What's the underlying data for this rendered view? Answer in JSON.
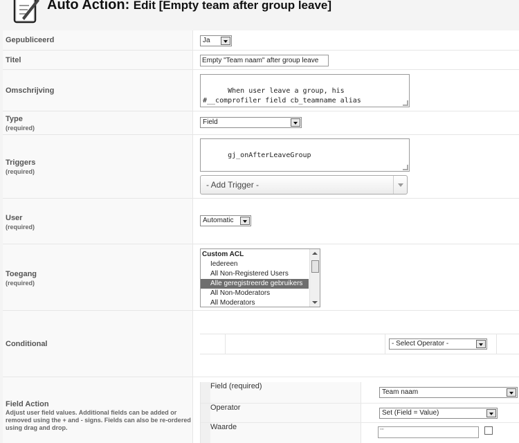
{
  "header": {
    "title_main": "Auto Action:",
    "title_sub": "Edit [Empty team after group leave]",
    "logo_icon": "document-edit-icon"
  },
  "fields": {
    "published": {
      "label": "Gepubliceerd",
      "value": "Ja"
    },
    "title": {
      "label": "Titel",
      "value": "Empty \"Team naam\" after group leave"
    },
    "description": {
      "label": "Omschrijving",
      "value": "When user leave a group, his\n#__comprofiler field cb_teamname alias\n\"Team naam\" has to become empty."
    },
    "type": {
      "label": "Type",
      "required": "(required)",
      "value": "Field"
    },
    "triggers": {
      "label": "Triggers",
      "required": "(required)",
      "value": "gj_onAfterLeaveGroup",
      "add_placeholder": "- Add Trigger -"
    },
    "user": {
      "label": "User",
      "required": "(required)",
      "value": "Automatic"
    },
    "access": {
      "label": "Toegang",
      "required": "(required)",
      "options": [
        {
          "label": "Custom ACL",
          "group": true,
          "selected": false
        },
        {
          "label": "Iedereen",
          "group": false,
          "selected": false
        },
        {
          "label": "All Non-Registered Users",
          "group": false,
          "selected": false
        },
        {
          "label": "Alle geregistreerde gebruikers",
          "group": false,
          "selected": true
        },
        {
          "label": "All Non-Moderators",
          "group": false,
          "selected": false
        },
        {
          "label": "All Moderators",
          "group": false,
          "selected": false
        }
      ]
    },
    "conditional": {
      "label": "Conditional",
      "operator_value": "- Select Operator -"
    },
    "field_action": {
      "label": "Field Action",
      "description": "Adjust user field values. Additional fields can be added or removed using the + and - signs. Fields can also be re-ordered using drag and drop.",
      "field_label": "Field",
      "field_required": "(required)",
      "field_value": "Team naam",
      "operator_label": "Operator",
      "operator_value": "Set (Field = Value)",
      "value_label": "Waarde",
      "value_value": "\"\""
    }
  }
}
